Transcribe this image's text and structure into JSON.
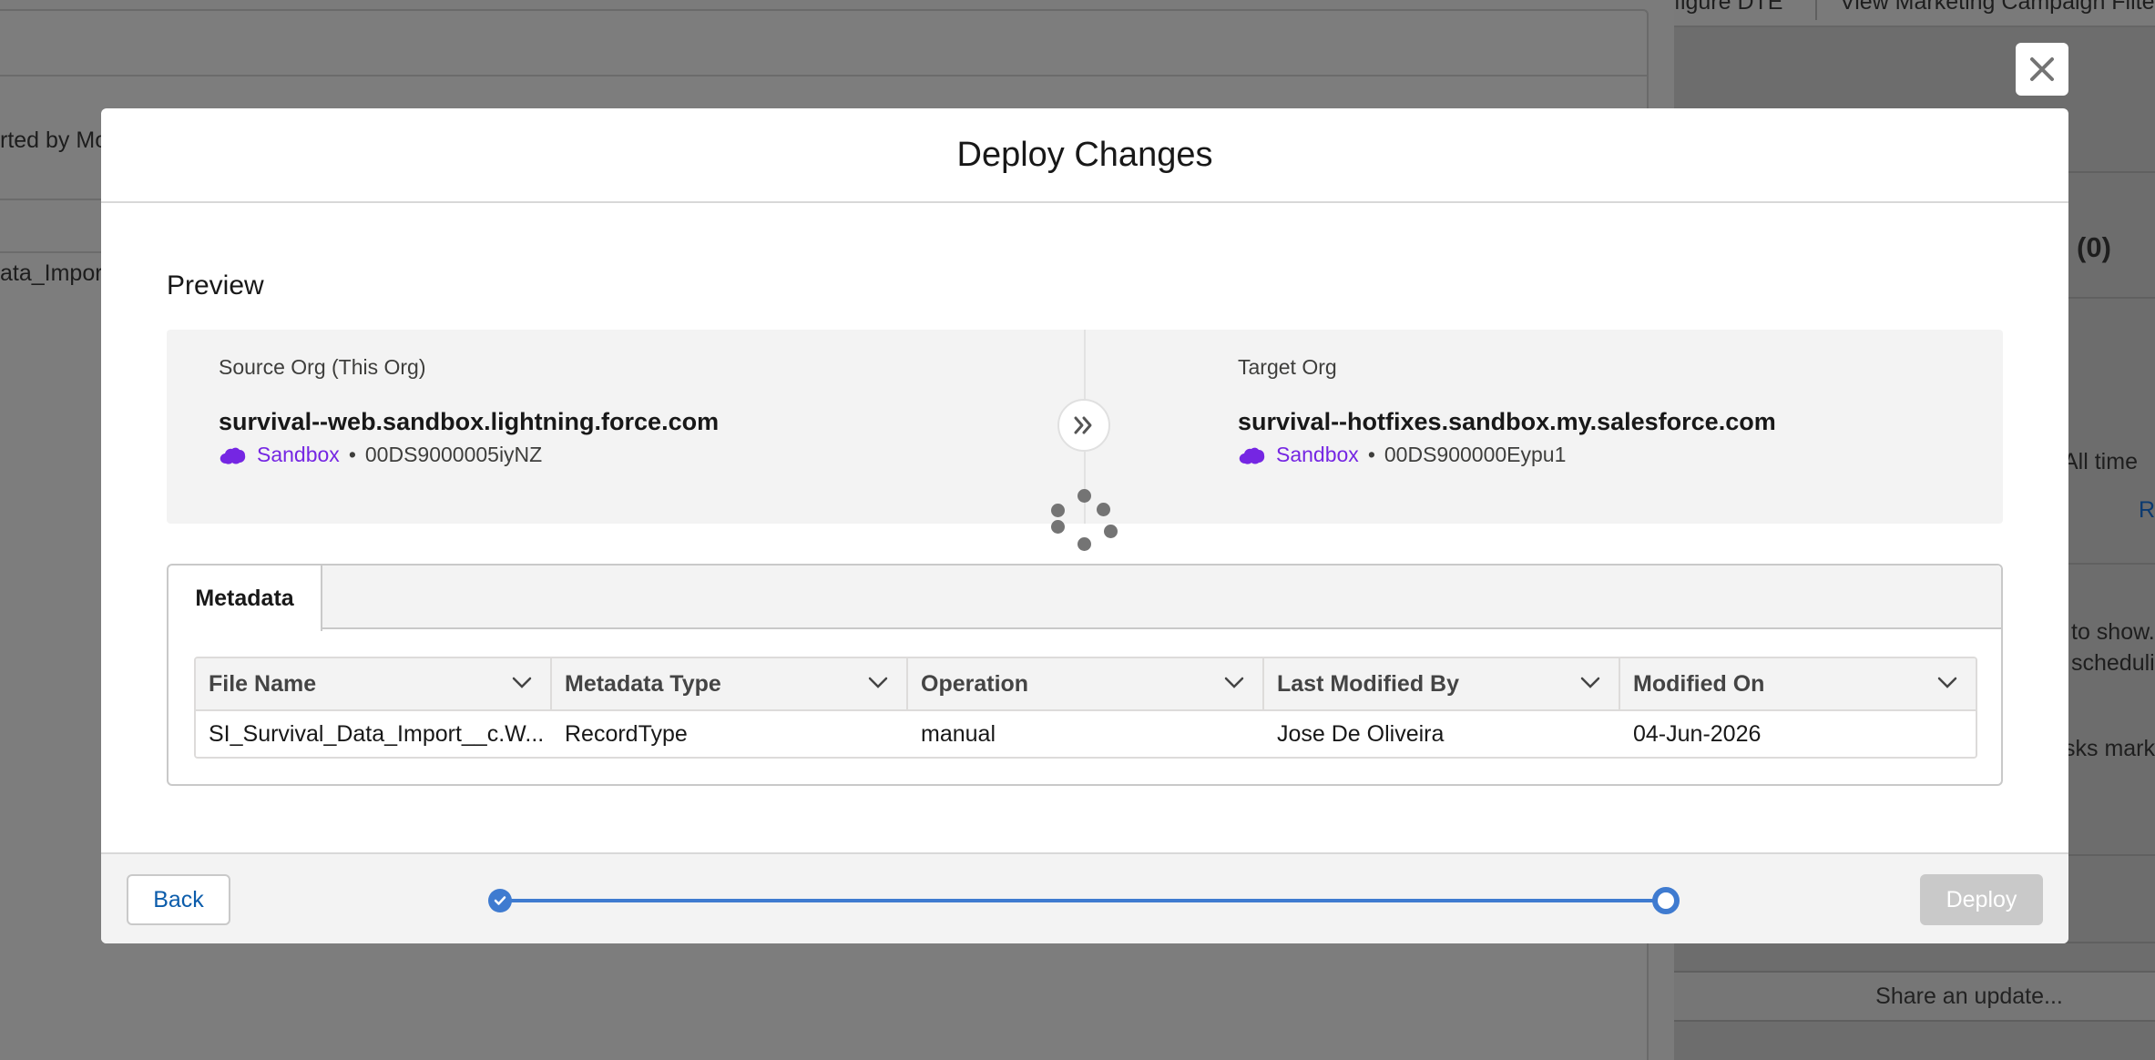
{
  "background": {
    "left_texts": [
      "rted by Mo",
      "ata_Import"
    ],
    "right_texts": {
      "top_tabs": [
        "figure DTE",
        "View Marketing Campaign Filter"
      ],
      "count": "(0)",
      "filter": "s: All time",
      "refresh": "Re",
      "empty_line1": "to show.",
      "empty_line2": "scheduli",
      "tasks": "sks mark",
      "share": "Share an update..."
    }
  },
  "modal": {
    "title": "Deploy Changes",
    "preview_label": "Preview",
    "source": {
      "caption": "Source Org (This Org)",
      "domain": "survival--web.sandbox.lightning.force.com",
      "type": "Sandbox",
      "separator": "•",
      "org_id": "00DS9000005iyNZ"
    },
    "target": {
      "caption": "Target Org",
      "domain": "survival--hotfixes.sandbox.my.salesforce.com",
      "type": "Sandbox",
      "separator": "•",
      "org_id": "00DS900000Eypu1"
    },
    "tabs": [
      {
        "label": "Metadata",
        "active": true
      }
    ],
    "table": {
      "columns": [
        "File Name",
        "Metadata Type",
        "Operation",
        "Last Modified By",
        "Modified On"
      ],
      "rows": [
        [
          "SI_Survival_Data_Import__c.W...",
          "RecordType",
          "manual",
          "Jose De Oliveira",
          "04-Jun-2026"
        ]
      ]
    },
    "footer": {
      "back_label": "Back",
      "deploy_label": "Deploy",
      "deploy_enabled": false,
      "progress_steps": [
        {
          "state": "complete"
        },
        {
          "state": "current"
        }
      ]
    }
  },
  "colors": {
    "accent": "#3f7bd0",
    "sandbox": "#7526e3",
    "link": "#0b5cab",
    "disabled": "#c9c9c9"
  },
  "icons": [
    "close-icon",
    "salesforce-cloud-icon",
    "double-chevron-right-icon",
    "loading-spinner-icon",
    "chevron-down-icon",
    "check-icon"
  ]
}
